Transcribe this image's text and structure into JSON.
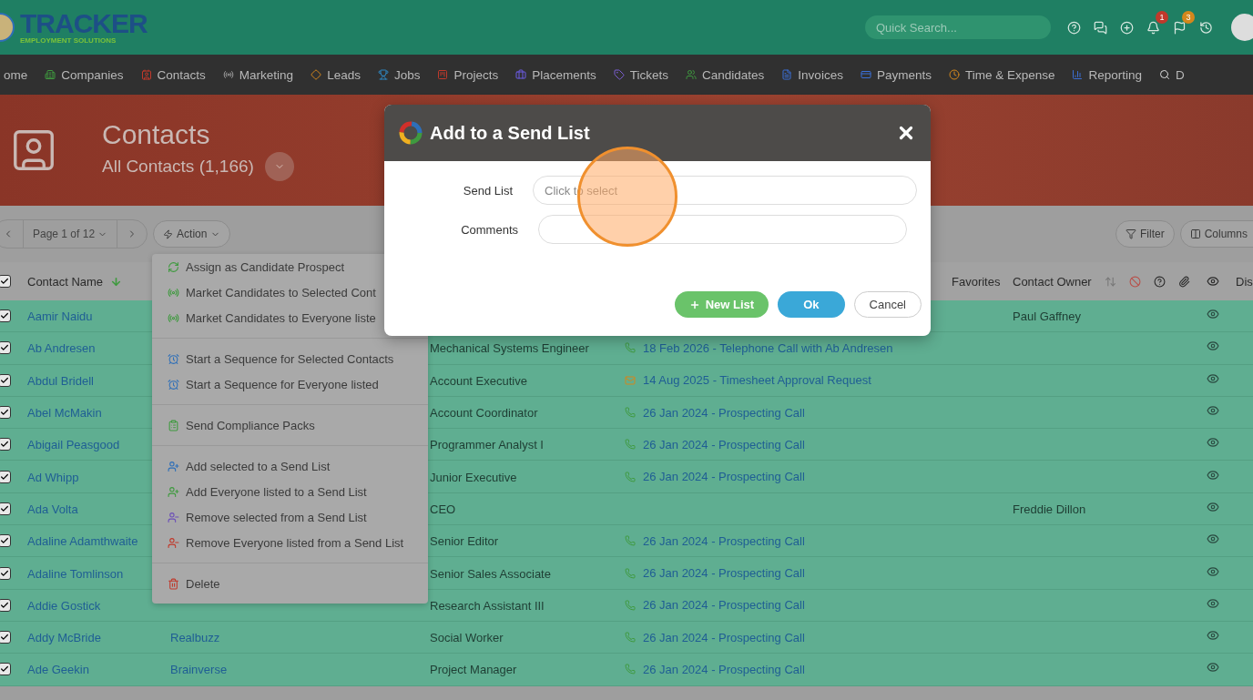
{
  "topbar": {
    "logo_title": "TRACKER",
    "logo_subtitle": "EMPLOYMENT SOLUTIONS",
    "search_placeholder": "Quick Search...",
    "icons": [
      {
        "kind": "help"
      },
      {
        "kind": "chat"
      },
      {
        "kind": "add"
      },
      {
        "kind": "bell",
        "badge": "1",
        "color": "#c0392b"
      },
      {
        "kind": "flag",
        "badge": "3",
        "color": "#d4871c"
      },
      {
        "kind": "history"
      }
    ]
  },
  "nav": [
    "ome",
    "Companies",
    "Contacts",
    "Marketing",
    "Leads",
    "Jobs",
    "Projects",
    "Placements",
    "Tickets",
    "Candidates",
    "Invoices",
    "Payments",
    "Time & Expense",
    "Reporting",
    "D"
  ],
  "header": {
    "title": "Contacts",
    "subtitle": "All Contacts (1,166)"
  },
  "toolbar": {
    "page": "Page 1 of 12",
    "action": "Action",
    "filter": "Filter",
    "columns": "Columns"
  },
  "action_menu": [
    {
      "items": [
        {
          "kind": "refresh",
          "label": "Assign as Candidate Prospect"
        },
        {
          "kind": "broadcast",
          "label": "Market Candidates to Selected Cont"
        },
        {
          "kind": "broadcast",
          "label": "Market Candidates to Everyone liste"
        }
      ]
    },
    {
      "items": [
        {
          "kind": "alarm",
          "label": "Start a Sequence for Selected Contacts"
        },
        {
          "kind": "alarm",
          "label": "Start a Sequence for Everyone listed"
        }
      ]
    },
    {
      "items": [
        {
          "kind": "clipboard",
          "label": "Send Compliance Packs"
        }
      ]
    },
    {
      "items": [
        {
          "kind": "add-selected",
          "label": "Add selected to a Send List"
        },
        {
          "kind": "add-all",
          "label": "Add Everyone listed to a Send List"
        },
        {
          "kind": "remove-selected",
          "label": "Remove selected from a Send List"
        },
        {
          "kind": "remove-all",
          "label": "Remove Everyone listed from a Send List"
        }
      ]
    },
    {
      "items": [
        {
          "kind": "trash",
          "label": "Delete"
        }
      ]
    }
  ],
  "table": {
    "all_checked": true,
    "columns": {
      "name": "Contact Name",
      "favorites": "Favorites",
      "owner": "Contact Owner",
      "partial": "Dis"
    },
    "rows": [
      {
        "checked": true,
        "name": "Aamir Naidu",
        "owner": "Paul Gaffney"
      },
      {
        "checked": true,
        "name": "Ab Andresen",
        "title": "Mechanical Systems Engineer",
        "activity": {
          "kind": "phone",
          "text": "18 Feb 2026 - Telephone Call with Ab Andresen"
        }
      },
      {
        "checked": true,
        "name": "Abdul Bridell",
        "title": "Account Executive",
        "activity": {
          "kind": "email",
          "text": "14 Aug 2025 - Timesheet Approval Request"
        }
      },
      {
        "checked": true,
        "name": "Abel McMakin",
        "title": "Account Coordinator",
        "activity": {
          "kind": "phone",
          "text": "26 Jan 2024 - Prospecting Call"
        }
      },
      {
        "checked": true,
        "name": "Abigail Peasgood",
        "title": "Programmer Analyst I",
        "activity": {
          "kind": "phone",
          "text": "26 Jan 2024 - Prospecting Call"
        }
      },
      {
        "checked": true,
        "name": "Ad Whipp",
        "title": "Junior Executive",
        "activity": {
          "kind": "phone",
          "text": "26 Jan 2024 - Prospecting Call"
        }
      },
      {
        "checked": true,
        "name": "Ada Volta",
        "title": "CEO",
        "owner": "Freddie Dillon"
      },
      {
        "checked": true,
        "name": "Adaline Adamthwaite",
        "title": "Senior Editor",
        "activity": {
          "kind": "phone",
          "text": "26 Jan 2024 - Prospecting Call"
        }
      },
      {
        "checked": true,
        "name": "Adaline Tomlinson",
        "title": "Senior Sales Associate",
        "activity": {
          "kind": "phone",
          "text": "26 Jan 2024 - Prospecting Call"
        }
      },
      {
        "checked": true,
        "name": "Addie Gostick",
        "title": "Research Assistant III",
        "activity": {
          "kind": "phone",
          "text": "26 Jan 2024 - Prospecting Call"
        }
      },
      {
        "checked": true,
        "name": "Addy McBride",
        "company": "Realbuzz",
        "title": "Social Worker",
        "activity": {
          "kind": "phone",
          "text": "26 Jan 2024 - Prospecting Call"
        }
      },
      {
        "checked": true,
        "name": "Ade Geekin",
        "company": "Brainverse",
        "title": "Project Manager",
        "activity": {
          "kind": "phone",
          "text": "26 Jan 2024 - Prospecting Call"
        }
      }
    ]
  },
  "dialog": {
    "title": "Add to a Send List",
    "fields": [
      {
        "label": "Send List",
        "placeholder": "Click to select"
      },
      {
        "label": "Comments"
      }
    ],
    "buttons": [
      {
        "kind": "new",
        "label": "New List"
      },
      {
        "kind": "ok",
        "label": "Ok"
      },
      {
        "kind": "cancel",
        "label": "Cancel"
      }
    ]
  }
}
